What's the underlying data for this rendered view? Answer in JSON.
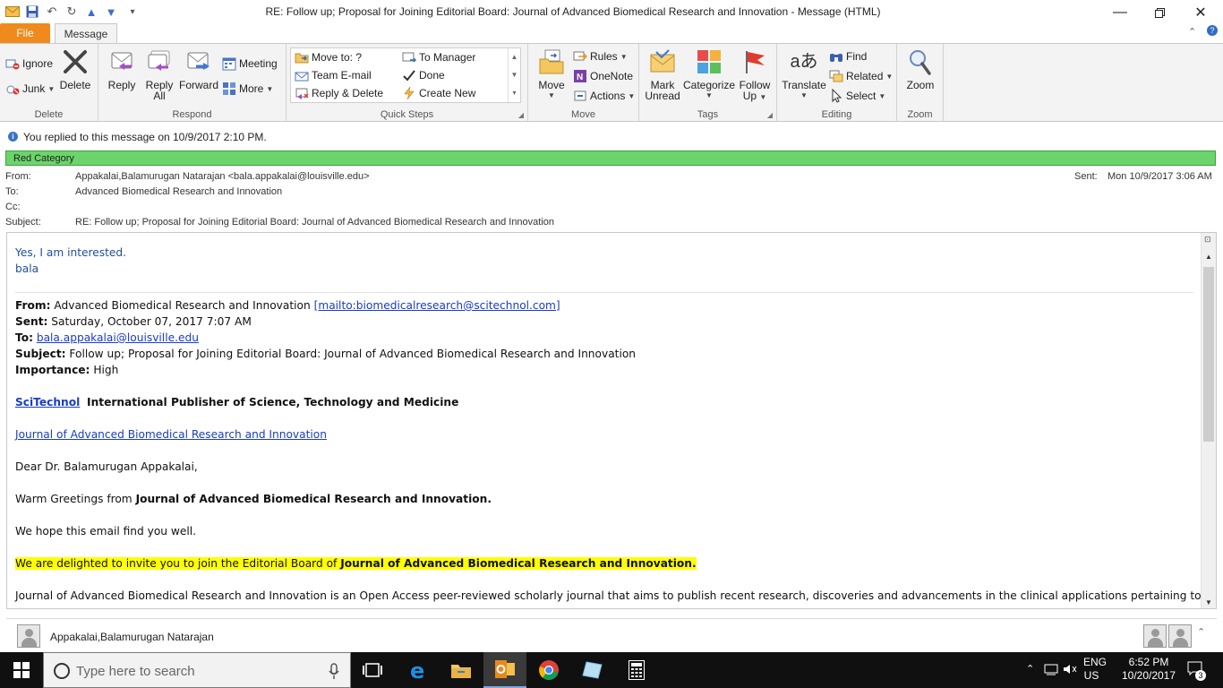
{
  "window": {
    "title": "RE: Follow up; Proposal for Joining Editorial Board: Journal of Advanced Biomedical Research and Innovation  -  Message (HTML)"
  },
  "tabs": {
    "file": "File",
    "message": "Message"
  },
  "ribbon": {
    "delete_group": {
      "label": "Delete",
      "ignore": "Ignore",
      "junk": "Junk",
      "delete": "Delete"
    },
    "respond_group": {
      "label": "Respond",
      "reply": "Reply",
      "reply_all_1": "Reply",
      "reply_all_2": "All",
      "forward": "Forward",
      "meeting": "Meeting",
      "more": "More"
    },
    "quick_steps": {
      "label": "Quick Steps",
      "move_to": "Move to: ?",
      "team_email": "Team E-mail",
      "reply_delete": "Reply & Delete",
      "to_manager": "To Manager",
      "done": "Done",
      "create_new": "Create New"
    },
    "move_group": {
      "label": "Move",
      "move": "Move",
      "rules": "Rules",
      "onenote": "OneNote",
      "actions": "Actions"
    },
    "tags_group": {
      "label": "Tags",
      "mark_unread_1": "Mark",
      "mark_unread_2": "Unread",
      "categorize": "Categorize",
      "follow_up_1": "Follow",
      "follow_up_2": "Up"
    },
    "editing_group": {
      "label": "Editing",
      "translate": "Translate",
      "find": "Find",
      "related": "Related",
      "select": "Select"
    },
    "zoom_group": {
      "label": "Zoom",
      "zoom": "Zoom"
    }
  },
  "info": {
    "replied": "You replied to this message on 10/9/2017 2:10 PM.",
    "category": "Red Category"
  },
  "headers": {
    "from_label": "From:",
    "from": "Appakalai,Balamurugan Natarajan <bala.appakalai@louisville.edu>",
    "to_label": "To:",
    "to": "Advanced Biomedical Research and Innovation",
    "cc_label": "Cc:",
    "subject_label": "Subject:",
    "subject": "RE: Follow up; Proposal for Joining Editorial Board: Journal of Advanced Biomedical Research and Innovation",
    "sent_label": "Sent:",
    "sent": "Mon 10/9/2017 3:06 AM"
  },
  "body": {
    "reply_line1": "Yes, I am interested.",
    "reply_line2": "bala",
    "orig_from_label": "From:",
    "orig_from": "Advanced Biomedical Research and Innovation",
    "orig_from_mail": "[mailto:biomedicalresearch@scitechnol.com]",
    "orig_sent_label": "Sent:",
    "orig_sent": "Saturday, October 07, 2017 7:07 AM",
    "orig_to_label": "To:",
    "orig_to": "bala.appakalai@louisville.edu",
    "orig_subject_label": "Subject:",
    "orig_subject": "Follow up; Proposal for Joining Editorial Board: Journal of Advanced Biomedical Research and Innovation",
    "orig_importance_label": "Importance:",
    "orig_importance": "High",
    "scitechnol": "SciTechnol",
    "publisher_tagline": "International Publisher of Science, Technology and Medicine",
    "journal_link": "Journal of Advanced Biomedical Research and Innovation",
    "greeting": "Dear Dr. Balamurugan Appakalai,",
    "warm_prefix": "Warm Greetings from ",
    "warm_journal": "Journal of Advanced Biomedical Research and Innovation.",
    "hope": "We hope this email find you well.",
    "invite_prefix": "We are delighted to invite you to join the Editorial Board of ",
    "invite_journal": "Journal of Advanced Biomedical Research and Innovation.",
    "para": "Journal of Advanced Biomedical Research and Innovation is an Open Access peer-reviewed scholarly journal that aims to publish recent research, discoveries and advancements in the clinical applications pertaining to"
  },
  "people": {
    "name": "Appakalai,Balamurugan Natarajan"
  },
  "taskbar": {
    "search_placeholder": "Type here to search",
    "lang1": "ENG",
    "lang2": "US",
    "time": "6:52 PM",
    "date": "10/20/2017",
    "notifications": "3"
  }
}
